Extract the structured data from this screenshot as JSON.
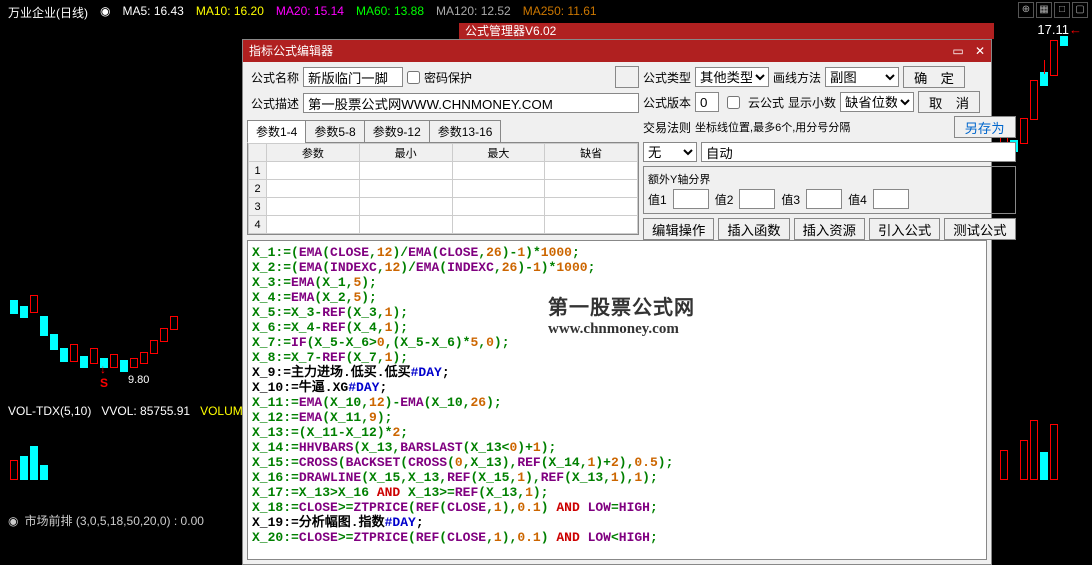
{
  "header": {
    "stock_name": "万业企业(日线)",
    "eye_icon": "◉",
    "ma5": "MA5: 16.43",
    "ma10": "MA10: 16.20",
    "ma20": "MA20: 15.14",
    "ma60": "MA60: 13.88",
    "ma120": "MA120: 12.52",
    "ma250": "MA250: 11.61"
  },
  "price_right": "17.11",
  "price_low": "9.80",
  "vol_line": {
    "label": "VOL-TDX(5,10)",
    "vvol": "VVOL: 85755.91",
    "volume": "VOLUM"
  },
  "bottom_label": "市场前排 (3,0,5,18,50,20,0)  : 0.00",
  "modal_bg_title": "公式管理器V6.02",
  "editor": {
    "title": "指标公式编辑器",
    "labels": {
      "name": "公式名称",
      "pwd_protect": "密码保护",
      "desc": "公式描述",
      "type": "公式类型",
      "draw_method": "画线方法",
      "version": "公式版本",
      "cloud": "云公式",
      "decimals": "显示小数",
      "trade_rule": "交易法则",
      "coord_hint": "坐标线位置,最多6个,用分号分隔",
      "extra_axis": "额外Y轴分界",
      "val1": "值1",
      "val2": "值2",
      "val3": "值3",
      "val4": "值4"
    },
    "values": {
      "name": "新版临门一脚",
      "desc": "第一股票公式网WWW.CHNMONEY.COM",
      "type": "其他类型",
      "draw_method": "副图",
      "version": "0",
      "decimals": "缺省位数",
      "trade_rule": "无",
      "coord": "自动"
    },
    "buttons": {
      "ok": "确　定",
      "cancel": "取　消",
      "save_as": "另存为",
      "edit_op": "编辑操作",
      "insert_func": "插入函数",
      "insert_res": "插入资源",
      "import_formula": "引入公式",
      "test": "测试公式"
    },
    "param_tabs": [
      "参数1-4",
      "参数5-8",
      "参数9-12",
      "参数13-16"
    ],
    "param_headers": [
      "参数",
      "最小",
      "最大",
      "缺省"
    ],
    "param_rows": [
      "1",
      "2",
      "3",
      "4"
    ]
  },
  "watermark": {
    "line1": "第一股票公式网",
    "line2": "www.chnmoney.com"
  },
  "code_lines": [
    [
      {
        "t": "X_1:=(",
        "c": "green"
      },
      {
        "t": "EMA",
        "c": "purple"
      },
      {
        "t": "(",
        "c": "green"
      },
      {
        "t": "CLOSE",
        "c": "purple"
      },
      {
        "t": ",",
        "c": "green"
      },
      {
        "t": "12",
        "c": "orange"
      },
      {
        "t": ")/",
        "c": "green"
      },
      {
        "t": "EMA",
        "c": "purple"
      },
      {
        "t": "(",
        "c": "green"
      },
      {
        "t": "CLOSE",
        "c": "purple"
      },
      {
        "t": ",",
        "c": "green"
      },
      {
        "t": "26",
        "c": "orange"
      },
      {
        "t": ")-",
        "c": "green"
      },
      {
        "t": "1",
        "c": "orange"
      },
      {
        "t": ")*",
        "c": "green"
      },
      {
        "t": "1000",
        "c": "orange"
      },
      {
        "t": ";",
        "c": "green"
      }
    ],
    [
      {
        "t": "X_2:=(",
        "c": "green"
      },
      {
        "t": "EMA",
        "c": "purple"
      },
      {
        "t": "(",
        "c": "green"
      },
      {
        "t": "INDEXC",
        "c": "purple"
      },
      {
        "t": ",",
        "c": "green"
      },
      {
        "t": "12",
        "c": "orange"
      },
      {
        "t": ")/",
        "c": "green"
      },
      {
        "t": "EMA",
        "c": "purple"
      },
      {
        "t": "(",
        "c": "green"
      },
      {
        "t": "INDEXC",
        "c": "purple"
      },
      {
        "t": ",",
        "c": "green"
      },
      {
        "t": "26",
        "c": "orange"
      },
      {
        "t": ")-",
        "c": "green"
      },
      {
        "t": "1",
        "c": "orange"
      },
      {
        "t": ")*",
        "c": "green"
      },
      {
        "t": "1000",
        "c": "orange"
      },
      {
        "t": ";",
        "c": "green"
      }
    ],
    [
      {
        "t": "X_3:=",
        "c": "green"
      },
      {
        "t": "EMA",
        "c": "purple"
      },
      {
        "t": "(X_1,",
        "c": "green"
      },
      {
        "t": "5",
        "c": "orange"
      },
      {
        "t": ");",
        "c": "green"
      }
    ],
    [
      {
        "t": "X_4:=",
        "c": "green"
      },
      {
        "t": "EMA",
        "c": "purple"
      },
      {
        "t": "(X_2,",
        "c": "green"
      },
      {
        "t": "5",
        "c": "orange"
      },
      {
        "t": ");",
        "c": "green"
      }
    ],
    [
      {
        "t": "X_5:=X_3-",
        "c": "green"
      },
      {
        "t": "REF",
        "c": "purple"
      },
      {
        "t": "(X_3,",
        "c": "green"
      },
      {
        "t": "1",
        "c": "orange"
      },
      {
        "t": ");",
        "c": "green"
      }
    ],
    [
      {
        "t": "X_6:=X_4-",
        "c": "green"
      },
      {
        "t": "REF",
        "c": "purple"
      },
      {
        "t": "(X_4,",
        "c": "green"
      },
      {
        "t": "1",
        "c": "orange"
      },
      {
        "t": ");",
        "c": "green"
      }
    ],
    [
      {
        "t": "X_7:=",
        "c": "green"
      },
      {
        "t": "IF",
        "c": "purple"
      },
      {
        "t": "(X_5-X_6>",
        "c": "green"
      },
      {
        "t": "0",
        "c": "orange"
      },
      {
        "t": ",(X_5-X_6)*",
        "c": "green"
      },
      {
        "t": "5",
        "c": "orange"
      },
      {
        "t": ",",
        "c": "green"
      },
      {
        "t": "0",
        "c": "orange"
      },
      {
        "t": ");",
        "c": "green"
      }
    ],
    [
      {
        "t": "X_8:=X_7-",
        "c": "green"
      },
      {
        "t": "REF",
        "c": "purple"
      },
      {
        "t": "(X_7,",
        "c": "green"
      },
      {
        "t": "1",
        "c": "orange"
      },
      {
        "t": ");",
        "c": "green"
      }
    ],
    [
      {
        "t": "X_9:=主力进场.低买.低买",
        "c": "black"
      },
      {
        "t": "#DAY",
        "c": "blue"
      },
      {
        "t": ";",
        "c": "black"
      }
    ],
    [
      {
        "t": "X_10:=牛逼.XG",
        "c": "black"
      },
      {
        "t": "#DAY",
        "c": "blue"
      },
      {
        "t": ";",
        "c": "black"
      }
    ],
    [
      {
        "t": "X_11:=",
        "c": "green"
      },
      {
        "t": "EMA",
        "c": "purple"
      },
      {
        "t": "(X_10,",
        "c": "green"
      },
      {
        "t": "12",
        "c": "orange"
      },
      {
        "t": ")-",
        "c": "green"
      },
      {
        "t": "EMA",
        "c": "purple"
      },
      {
        "t": "(X_10,",
        "c": "green"
      },
      {
        "t": "26",
        "c": "orange"
      },
      {
        "t": ");",
        "c": "green"
      }
    ],
    [
      {
        "t": "X_12:=",
        "c": "green"
      },
      {
        "t": "EMA",
        "c": "purple"
      },
      {
        "t": "(X_11,",
        "c": "green"
      },
      {
        "t": "9",
        "c": "orange"
      },
      {
        "t": ");",
        "c": "green"
      }
    ],
    [
      {
        "t": "X_13:=(X_11-X_12)*",
        "c": "green"
      },
      {
        "t": "2",
        "c": "orange"
      },
      {
        "t": ";",
        "c": "green"
      }
    ],
    [
      {
        "t": "X_14:=",
        "c": "green"
      },
      {
        "t": "HHVBARS",
        "c": "purple"
      },
      {
        "t": "(X_13,",
        "c": "green"
      },
      {
        "t": "BARSLAST",
        "c": "purple"
      },
      {
        "t": "(X_13<",
        "c": "green"
      },
      {
        "t": "0",
        "c": "orange"
      },
      {
        "t": ")+",
        "c": "green"
      },
      {
        "t": "1",
        "c": "orange"
      },
      {
        "t": ");",
        "c": "green"
      }
    ],
    [
      {
        "t": "X_15:=",
        "c": "green"
      },
      {
        "t": "CROSS",
        "c": "purple"
      },
      {
        "t": "(",
        "c": "green"
      },
      {
        "t": "BACKSET",
        "c": "purple"
      },
      {
        "t": "(",
        "c": "green"
      },
      {
        "t": "CROSS",
        "c": "purple"
      },
      {
        "t": "(",
        "c": "green"
      },
      {
        "t": "0",
        "c": "orange"
      },
      {
        "t": ",X_13),",
        "c": "green"
      },
      {
        "t": "REF",
        "c": "purple"
      },
      {
        "t": "(X_14,",
        "c": "green"
      },
      {
        "t": "1",
        "c": "orange"
      },
      {
        "t": ")+",
        "c": "green"
      },
      {
        "t": "2",
        "c": "orange"
      },
      {
        "t": "),",
        "c": "green"
      },
      {
        "t": "0.5",
        "c": "orange"
      },
      {
        "t": ");",
        "c": "green"
      }
    ],
    [
      {
        "t": "X_16:=",
        "c": "green"
      },
      {
        "t": "DRAWLINE",
        "c": "purple"
      },
      {
        "t": "(X_15,X_13,",
        "c": "green"
      },
      {
        "t": "REF",
        "c": "purple"
      },
      {
        "t": "(X_15,",
        "c": "green"
      },
      {
        "t": "1",
        "c": "orange"
      },
      {
        "t": "),",
        "c": "green"
      },
      {
        "t": "REF",
        "c": "purple"
      },
      {
        "t": "(X_13,",
        "c": "green"
      },
      {
        "t": "1",
        "c": "orange"
      },
      {
        "t": "),",
        "c": "green"
      },
      {
        "t": "1",
        "c": "orange"
      },
      {
        "t": ");",
        "c": "green"
      }
    ],
    [
      {
        "t": "X_17:=X_13>X_16 ",
        "c": "green"
      },
      {
        "t": "AND",
        "c": "red"
      },
      {
        "t": " X_13>=",
        "c": "green"
      },
      {
        "t": "REF",
        "c": "purple"
      },
      {
        "t": "(X_13,",
        "c": "green"
      },
      {
        "t": "1",
        "c": "orange"
      },
      {
        "t": ");",
        "c": "green"
      }
    ],
    [
      {
        "t": "X_18:=",
        "c": "green"
      },
      {
        "t": "CLOSE",
        "c": "purple"
      },
      {
        "t": ">=",
        "c": "green"
      },
      {
        "t": "ZTPRICE",
        "c": "purple"
      },
      {
        "t": "(",
        "c": "green"
      },
      {
        "t": "REF",
        "c": "purple"
      },
      {
        "t": "(",
        "c": "green"
      },
      {
        "t": "CLOSE",
        "c": "purple"
      },
      {
        "t": ",",
        "c": "green"
      },
      {
        "t": "1",
        "c": "orange"
      },
      {
        "t": "),",
        "c": "green"
      },
      {
        "t": "0.1",
        "c": "orange"
      },
      {
        "t": ") ",
        "c": "green"
      },
      {
        "t": "AND",
        "c": "red"
      },
      {
        "t": " ",
        "c": "green"
      },
      {
        "t": "LOW",
        "c": "purple"
      },
      {
        "t": "=",
        "c": "green"
      },
      {
        "t": "HIGH",
        "c": "purple"
      },
      {
        "t": ";",
        "c": "green"
      }
    ],
    [
      {
        "t": "X_19:=分析幅图.指数",
        "c": "black"
      },
      {
        "t": "#DAY",
        "c": "blue"
      },
      {
        "t": ";",
        "c": "black"
      }
    ],
    [
      {
        "t": "X_20:=",
        "c": "green"
      },
      {
        "t": "CLOSE",
        "c": "purple"
      },
      {
        "t": ">=",
        "c": "green"
      },
      {
        "t": "ZTPRICE",
        "c": "purple"
      },
      {
        "t": "(",
        "c": "green"
      },
      {
        "t": "REF",
        "c": "purple"
      },
      {
        "t": "(",
        "c": "green"
      },
      {
        "t": "CLOSE",
        "c": "purple"
      },
      {
        "t": ",",
        "c": "green"
      },
      {
        "t": "1",
        "c": "orange"
      },
      {
        "t": "),",
        "c": "green"
      },
      {
        "t": "0.1",
        "c": "orange"
      },
      {
        "t": ") ",
        "c": "green"
      },
      {
        "t": "AND",
        "c": "red"
      },
      {
        "t": " ",
        "c": "green"
      },
      {
        "t": "LOW",
        "c": "purple"
      },
      {
        "t": "<",
        "c": "green"
      },
      {
        "t": "HIGH",
        "c": "purple"
      },
      {
        "t": ";",
        "c": "green"
      }
    ]
  ]
}
